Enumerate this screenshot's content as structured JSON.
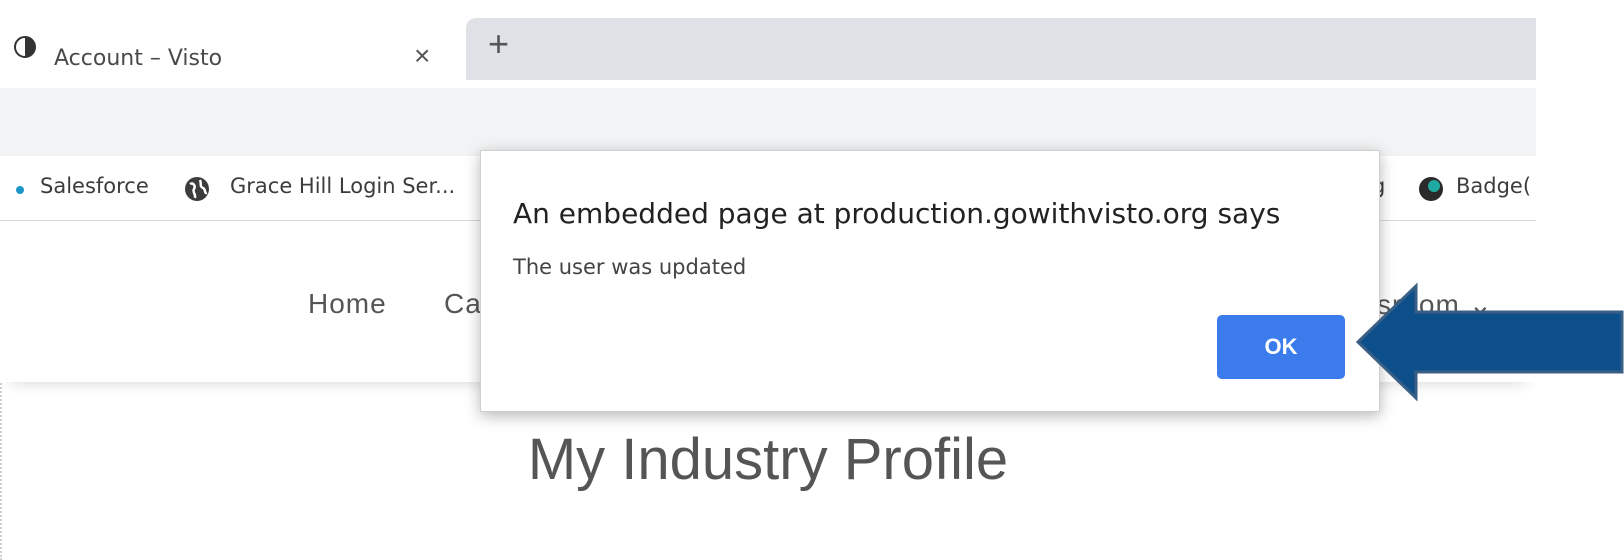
{
  "browser": {
    "tab_title": "Account – Visto",
    "tab_close": "×",
    "new_tab": "+"
  },
  "bookmarks": [
    {
      "label": "Salesforce",
      "icon": "bookmark-dot-icon"
    },
    {
      "label": "Grace Hill Login Ser...",
      "icon": "globe-icon"
    },
    {
      "label": "g",
      "icon": ""
    },
    {
      "label": "Badge(",
      "icon": "badge-icon"
    }
  ],
  "site_nav": {
    "home": "Home",
    "partial_left": "Ca",
    "partial_right": "ssroom ⌄"
  },
  "page": {
    "title": "My Industry Profile"
  },
  "dialog": {
    "heading": "An embedded page at production.gowithvisto.org says",
    "message": "The user was updated",
    "ok_label": "OK"
  },
  "colors": {
    "accent_button": "#3b7bec",
    "arrow_fill": "#0d4f8b",
    "arrow_stroke": "#3a5f85"
  }
}
